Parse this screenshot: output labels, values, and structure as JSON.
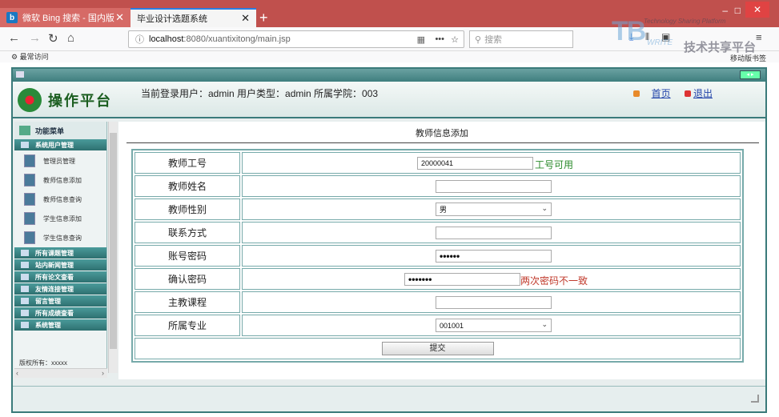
{
  "browser": {
    "tabs": [
      {
        "label": "微软 Bing 搜索 - 国内版",
        "fav": "b"
      },
      {
        "label": "毕业设计选题系统"
      }
    ],
    "new_tab_label": "+",
    "minimize": "–",
    "restore": "□",
    "close": "✕",
    "url_host": "localhost",
    "url_path": ":8080/xuantixitong/main.jsp",
    "search_placeholder": "搜索",
    "bookmark_label": "最常访问",
    "mobile_bookmark": "移动版书签",
    "icons": [
      "back-icon",
      "forward-icon",
      "reload-icon",
      "home-icon",
      "info-icon",
      "reader-icon",
      "more-icon",
      "star-icon",
      "search-icon",
      "download-icon",
      "library-icon",
      "sidebar-icon",
      "menu-icon"
    ]
  },
  "watermark": {
    "big": "TB",
    "sub": "Technology Sharing Platform",
    "sub2": "WRITE",
    "cn": "技术共享平台"
  },
  "app": {
    "logo_text": "操作平台",
    "user_info": "当前登录用户：admin   用户类型：admin   所属学院：003",
    "links": {
      "home": "首页",
      "logout": "退出"
    }
  },
  "sidebar": {
    "title": "功能菜单",
    "groups_top": [
      {
        "label": "系统用户管理"
      }
    ],
    "items": [
      {
        "label": "管理员管理"
      },
      {
        "label": "教师信息添加"
      },
      {
        "label": "教师信息查询"
      },
      {
        "label": "学生信息添加"
      },
      {
        "label": "学生信息查询"
      }
    ],
    "groups_bottom": [
      {
        "label": "所有课题管理"
      },
      {
        "label": "站内新闻管理"
      },
      {
        "label": "所有论文查看"
      },
      {
        "label": "友情连接管理"
      },
      {
        "label": "留言管理"
      },
      {
        "label": "所有成绩查看"
      },
      {
        "label": "系统管理"
      }
    ],
    "copyright": "版权所有：xxxxx"
  },
  "form": {
    "title": "教师信息添加",
    "teacher_id_label": "教师工号",
    "teacher_id_value": "20000041",
    "teacher_id_ok": "工号可用",
    "name_label": "教师姓名",
    "name_value": "",
    "gender_label": "教师性别",
    "gender_value": "男",
    "contact_label": "联系方式",
    "contact_value": "",
    "password_label": "账号密码",
    "password_value": "••••••",
    "confirm_label": "确认密码",
    "confirm_value": "•••••••",
    "confirm_error": "两次密码不一致",
    "course_label": "主教课程",
    "course_value": "",
    "major_label": "所属专业",
    "major_value": "001001",
    "submit_label": "提交"
  }
}
